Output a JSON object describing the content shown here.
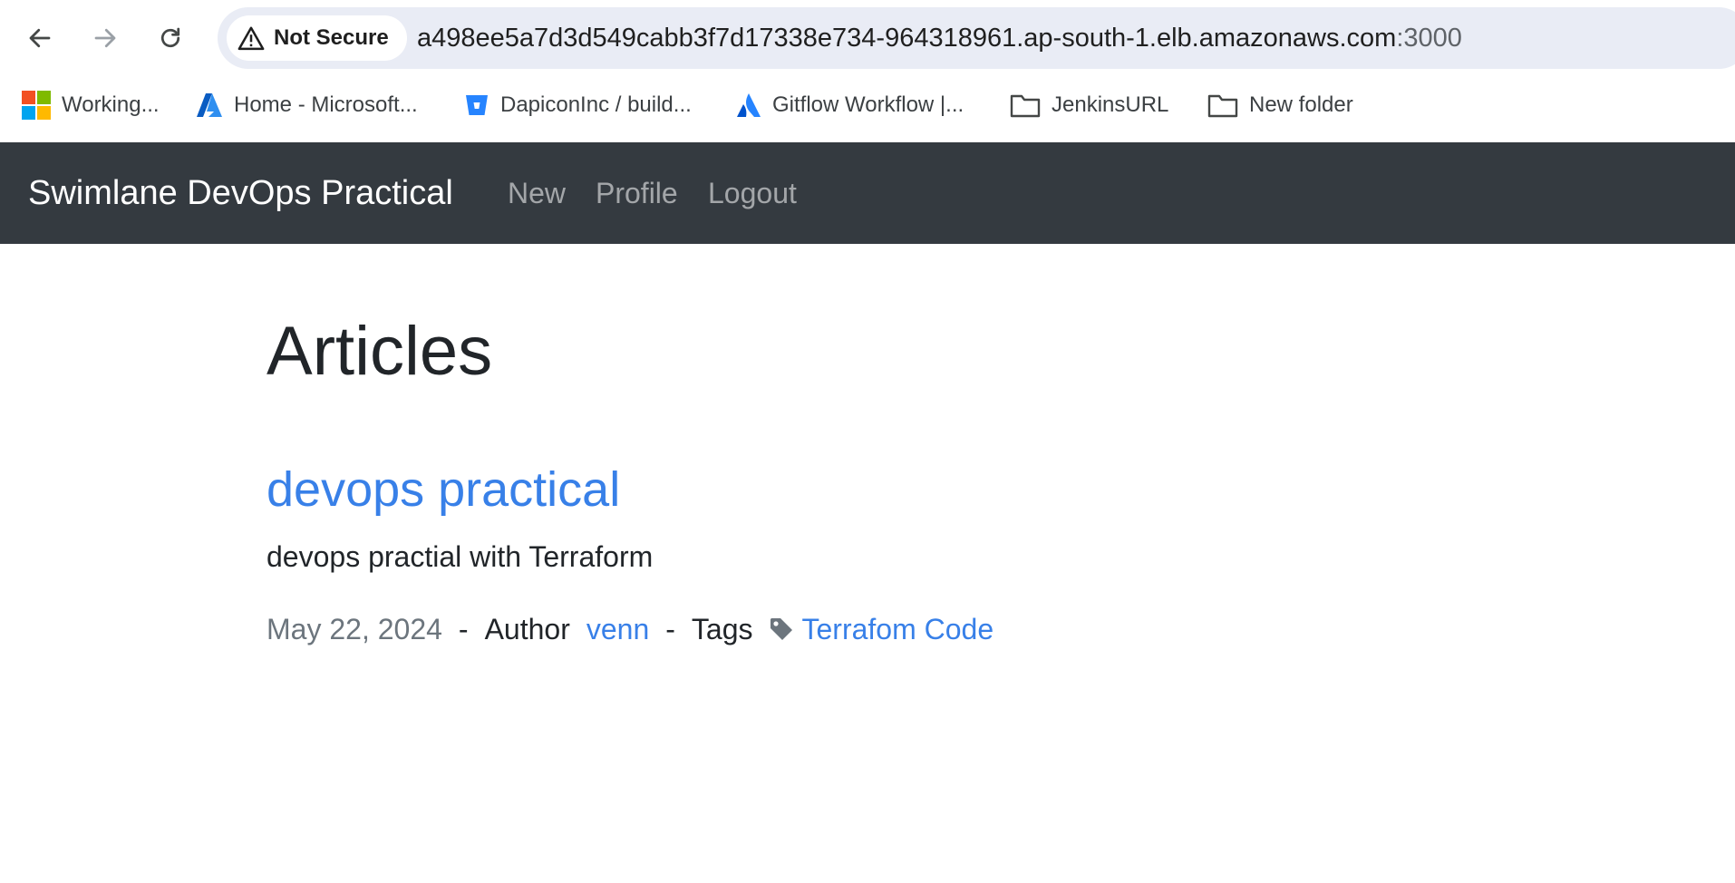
{
  "browser": {
    "security_chip": "Not Secure",
    "url_host": "a498ee5a7d3d549cabb3f7d17338e734-964318961.ap-south-1.elb.amazonaws.com",
    "url_port": ":3000",
    "bookmarks": [
      {
        "label": "Working...",
        "icon": "microsoft-icon"
      },
      {
        "label": "Home - Microsoft...",
        "icon": "azure-icon"
      },
      {
        "label": "DapiconInc / build...",
        "icon": "bitbucket-icon"
      },
      {
        "label": "Gitflow Workflow |...",
        "icon": "atlassian-icon"
      },
      {
        "label": "JenkinsURL",
        "icon": "folder-icon"
      },
      {
        "label": "New folder",
        "icon": "folder-icon"
      }
    ]
  },
  "navbar": {
    "brand": "Swimlane DevOps Practical",
    "links": [
      "New",
      "Profile",
      "Logout"
    ],
    "background": "#343a40"
  },
  "main": {
    "heading": "Articles",
    "articles": [
      {
        "title": "devops practical",
        "description": "devops practial with Terraform",
        "date": "May 22, 2024",
        "separator": "-",
        "author_label": "Author",
        "author": "venn",
        "tags_label": "Tags",
        "tag": "Terrafom Code"
      }
    ]
  },
  "colors": {
    "link": "#3880e8",
    "muted": "#6c757d",
    "text": "#212529"
  }
}
